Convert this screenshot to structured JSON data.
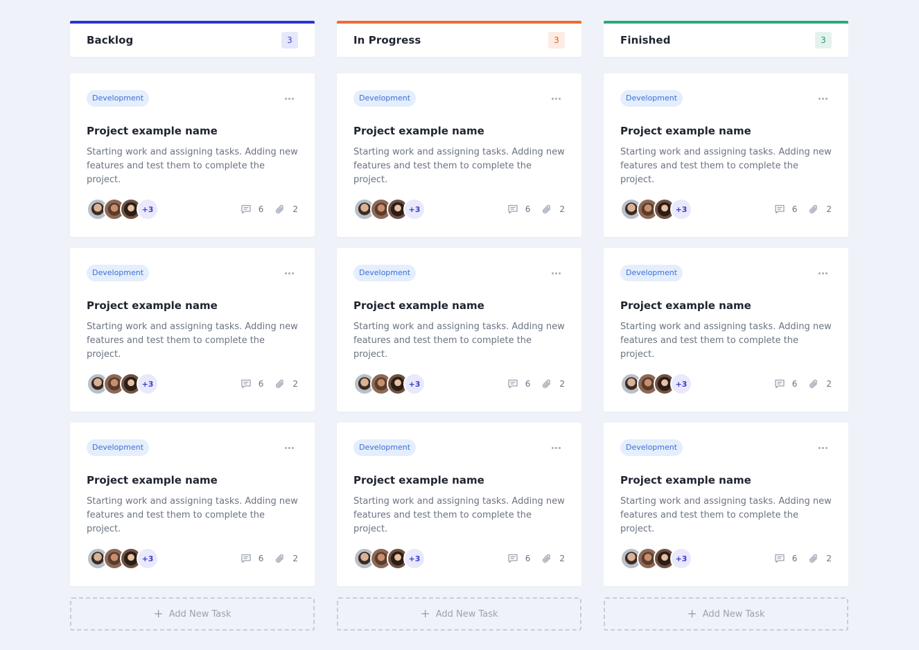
{
  "columns": [
    {
      "title": "Backlog",
      "count": "3",
      "accent": "#2c35d1",
      "badge_bg": "#e6e7fb",
      "badge_fg": "#3a3fd0",
      "cards": [
        {
          "tag": "Development",
          "title": "Project example name",
          "description": "Starting work and assigning tasks. Adding new features and test them to complete the project.",
          "extra_members": "+3",
          "comments": "6",
          "attachments": "2"
        },
        {
          "tag": "Development",
          "title": "Project example name",
          "description": "Starting work and assigning tasks. Adding new features and test them to complete the project.",
          "extra_members": "+3",
          "comments": "6",
          "attachments": "2"
        },
        {
          "tag": "Development",
          "title": "Project example name",
          "description": "Starting work and assigning tasks. Adding new features and test them to complete the project.",
          "extra_members": "+3",
          "comments": "6",
          "attachments": "2"
        }
      ],
      "add_label": "Add New Task"
    },
    {
      "title": "In Progress",
      "count": "3",
      "accent": "#f06a2f",
      "badge_bg": "#fdece4",
      "badge_fg": "#e2592b",
      "cards": [
        {
          "tag": "Development",
          "title": "Project example name",
          "description": "Starting work and assigning tasks. Adding new features and test them to complete the project.",
          "extra_members": "+3",
          "comments": "6",
          "attachments": "2"
        },
        {
          "tag": "Development",
          "title": "Project example name",
          "description": "Starting work and assigning tasks. Adding new features and test them to complete the project.",
          "extra_members": "+3",
          "comments": "6",
          "attachments": "2"
        },
        {
          "tag": "Development",
          "title": "Project example name",
          "description": "Starting work and assigning tasks. Adding new features and test them to complete the project.",
          "extra_members": "+3",
          "comments": "6",
          "attachments": "2"
        }
      ],
      "add_label": "Add New Task"
    },
    {
      "title": "Finished",
      "count": "3",
      "accent": "#2aa87a",
      "badge_bg": "#e3f2ec",
      "badge_fg": "#2a9a6f",
      "cards": [
        {
          "tag": "Development",
          "title": "Project example name",
          "description": "Starting work and assigning tasks. Adding new features and test them to complete the project.",
          "extra_members": "+3",
          "comments": "6",
          "attachments": "2"
        },
        {
          "tag": "Development",
          "title": "Project example name",
          "description": "Starting work and assigning tasks. Adding new features and test them to complete the project.",
          "extra_members": "+3",
          "comments": "6",
          "attachments": "2"
        },
        {
          "tag": "Development",
          "title": "Project example name",
          "description": "Starting work and assigning tasks. Adding new features and test them to complete the project.",
          "extra_members": "+3",
          "comments": "6",
          "attachments": "2"
        }
      ],
      "add_label": "Add New Task"
    }
  ],
  "icons": {
    "card_menu": "more-horizontal-icon",
    "comments": "comment-icon",
    "attachments": "paperclip-icon",
    "add": "plus-icon"
  }
}
